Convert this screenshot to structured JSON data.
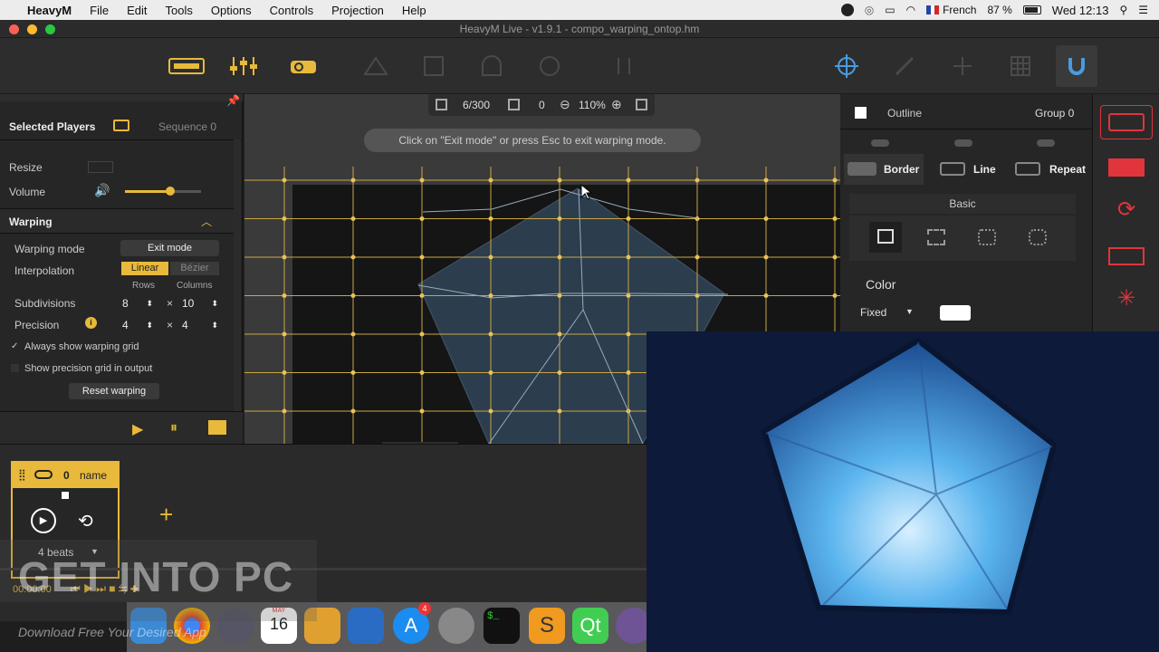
{
  "menubar": {
    "app": "HeavyM",
    "items": [
      "File",
      "Edit",
      "Tools",
      "Options",
      "Controls",
      "Projection",
      "Help"
    ],
    "language": "French",
    "battery": "87 %",
    "clock": "Wed 12:13"
  },
  "window": {
    "title": "HeavyM Live - v1.9.1 - compo_warping_ontop.hm"
  },
  "canvas_bar": {
    "faces": "6/300",
    "selected": "0",
    "zoom": "110%"
  },
  "hint": "Click on \"Exit mode\" or press Esc to exit warping mode.",
  "left": {
    "tab_players": "Selected Players",
    "tab_sequence": "Sequence 0",
    "resize": "Resize",
    "volume": "Volume",
    "volume_level": 0.6,
    "warping_header": "Warping",
    "warping_mode": "Warping mode",
    "exit_mode": "Exit mode",
    "interpolation": "Interpolation",
    "linear": "Linear",
    "bezier": "Bézier",
    "rows_label": "Rows",
    "columns_label": "Columns",
    "subdivisions": "Subdivisions",
    "sub_rows": "8",
    "sub_cols": "10",
    "precision": "Precision",
    "prec_rows": "4",
    "prec_cols": "4",
    "times": "×",
    "always_show": "Always show warping grid",
    "show_precision": "Show precision grid in output",
    "reset": "Reset warping"
  },
  "right": {
    "outline": "Outline",
    "group": "Group 0",
    "border": "Border",
    "line": "Line",
    "repeat": "Repeat",
    "basic": "Basic",
    "color": "Color",
    "fixed": "Fixed",
    "color_value": "#ffffff"
  },
  "timeline": {
    "index": "0",
    "name": "name",
    "beats": "4 beats",
    "time": "00:00:00"
  },
  "dock": {
    "calendar_month": "MAY",
    "calendar_day": "16",
    "appstore_badge": "4",
    "terminal": "$_"
  },
  "watermark": {
    "title": "GET INTO PC",
    "subtitle": "Download Free Your Desired App"
  },
  "colors": {
    "accent": "#e8b93a",
    "red": "#e0353c",
    "bg": "#2d2d2d"
  }
}
